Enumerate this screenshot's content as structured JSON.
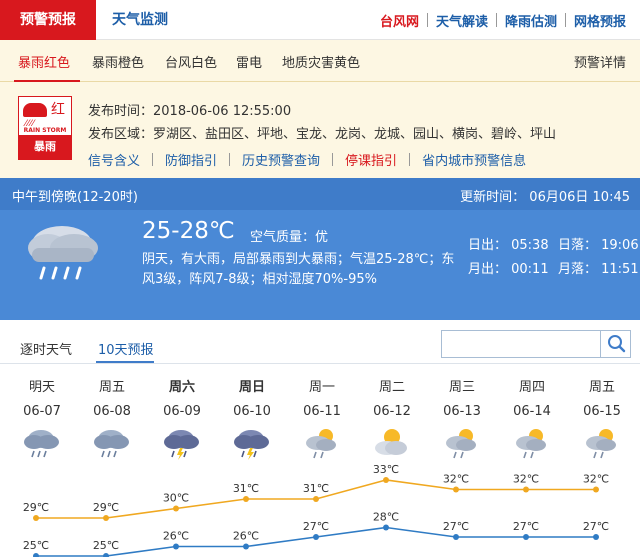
{
  "topnav": {
    "active_tab": "预警预报",
    "weather_tab": "天气监测",
    "links": [
      "台风网",
      "天气解读",
      "降雨估测",
      "网格预报"
    ]
  },
  "warning": {
    "tabs": [
      "暴雨红色",
      "暴雨橙色",
      "台风白色",
      "雷电",
      "地质灾害黄色"
    ],
    "details_link": "预警详情",
    "icon": {
      "level": "红",
      "en": "RAIN STORM",
      "cn": "暴雨"
    },
    "release_label": "发布时间：",
    "release_time": "2018-06-06 12:55:00",
    "area_label": "发布区域：",
    "areas": "罗湖区、盐田区、坪地、宝龙、龙岗、龙城、园山、横岗、碧岭、坪山",
    "links": [
      "信号含义",
      "防御指引",
      "历史预警查询",
      "停课指引",
      "省内城市预警信息"
    ]
  },
  "now": {
    "period": "中午到傍晚(12-20时)",
    "update": "更新时间：   06月06日 10:45",
    "temp": "25-28℃",
    "aq_label": "空气质量：",
    "aq_value": "优",
    "desc": "阴天，有大雨，局部暴雨到大暴雨；气温25-28℃；东风3级，阵风7-8级；相对湿度70%-95%",
    "sunrise": "日出：   05:38",
    "sunset": "日落：   19:06",
    "moonrise": "月出：   00:11",
    "moonset": "月落：   11:51"
  },
  "forecast_tabs": [
    "逐时天气",
    "10天预报"
  ],
  "days": [
    {
      "wk": "明天",
      "date": "06-07",
      "bold": false,
      "icon": "rain-cloud-icon",
      "high": "29℃",
      "low": "25℃"
    },
    {
      "wk": "周五",
      "date": "06-08",
      "bold": false,
      "icon": "rain-cloud-icon",
      "high": "29℃",
      "low": "25℃"
    },
    {
      "wk": "周六",
      "date": "06-09",
      "bold": true,
      "icon": "thunder-rain-icon",
      "high": "30℃",
      "low": "26℃"
    },
    {
      "wk": "周日",
      "date": "06-10",
      "bold": true,
      "icon": "thunder-rain-icon",
      "high": "31℃",
      "low": "26℃"
    },
    {
      "wk": "周一",
      "date": "06-11",
      "bold": false,
      "icon": "sun-cloud-rain-icon",
      "high": "31℃",
      "low": "27℃"
    },
    {
      "wk": "周二",
      "date": "06-12",
      "bold": false,
      "icon": "sun-cloud-icon",
      "high": "33℃",
      "low": "28℃"
    },
    {
      "wk": "周三",
      "date": "06-13",
      "bold": false,
      "icon": "sun-cloud-rain-icon",
      "high": "32℃",
      "low": "27℃"
    },
    {
      "wk": "周四",
      "date": "06-14",
      "bold": false,
      "icon": "sun-cloud-rain-icon",
      "high": "32℃",
      "low": "27℃"
    },
    {
      "wk": "周五",
      "date": "06-15",
      "bold": false,
      "icon": "sun-cloud-rain-icon",
      "high": "32℃",
      "low": "27℃"
    }
  ],
  "chart_data": {
    "type": "line",
    "categories": [
      "06-07",
      "06-08",
      "06-09",
      "06-10",
      "06-11",
      "06-12",
      "06-13",
      "06-14",
      "06-15"
    ],
    "series": [
      {
        "values": [
          29,
          29,
          30,
          31,
          31,
          33,
          32,
          32,
          32
        ],
        "color": "#f0a820"
      },
      {
        "values": [
          25,
          25,
          26,
          26,
          27,
          28,
          27,
          27,
          27
        ],
        "color": "#2f7bc4"
      }
    ]
  }
}
